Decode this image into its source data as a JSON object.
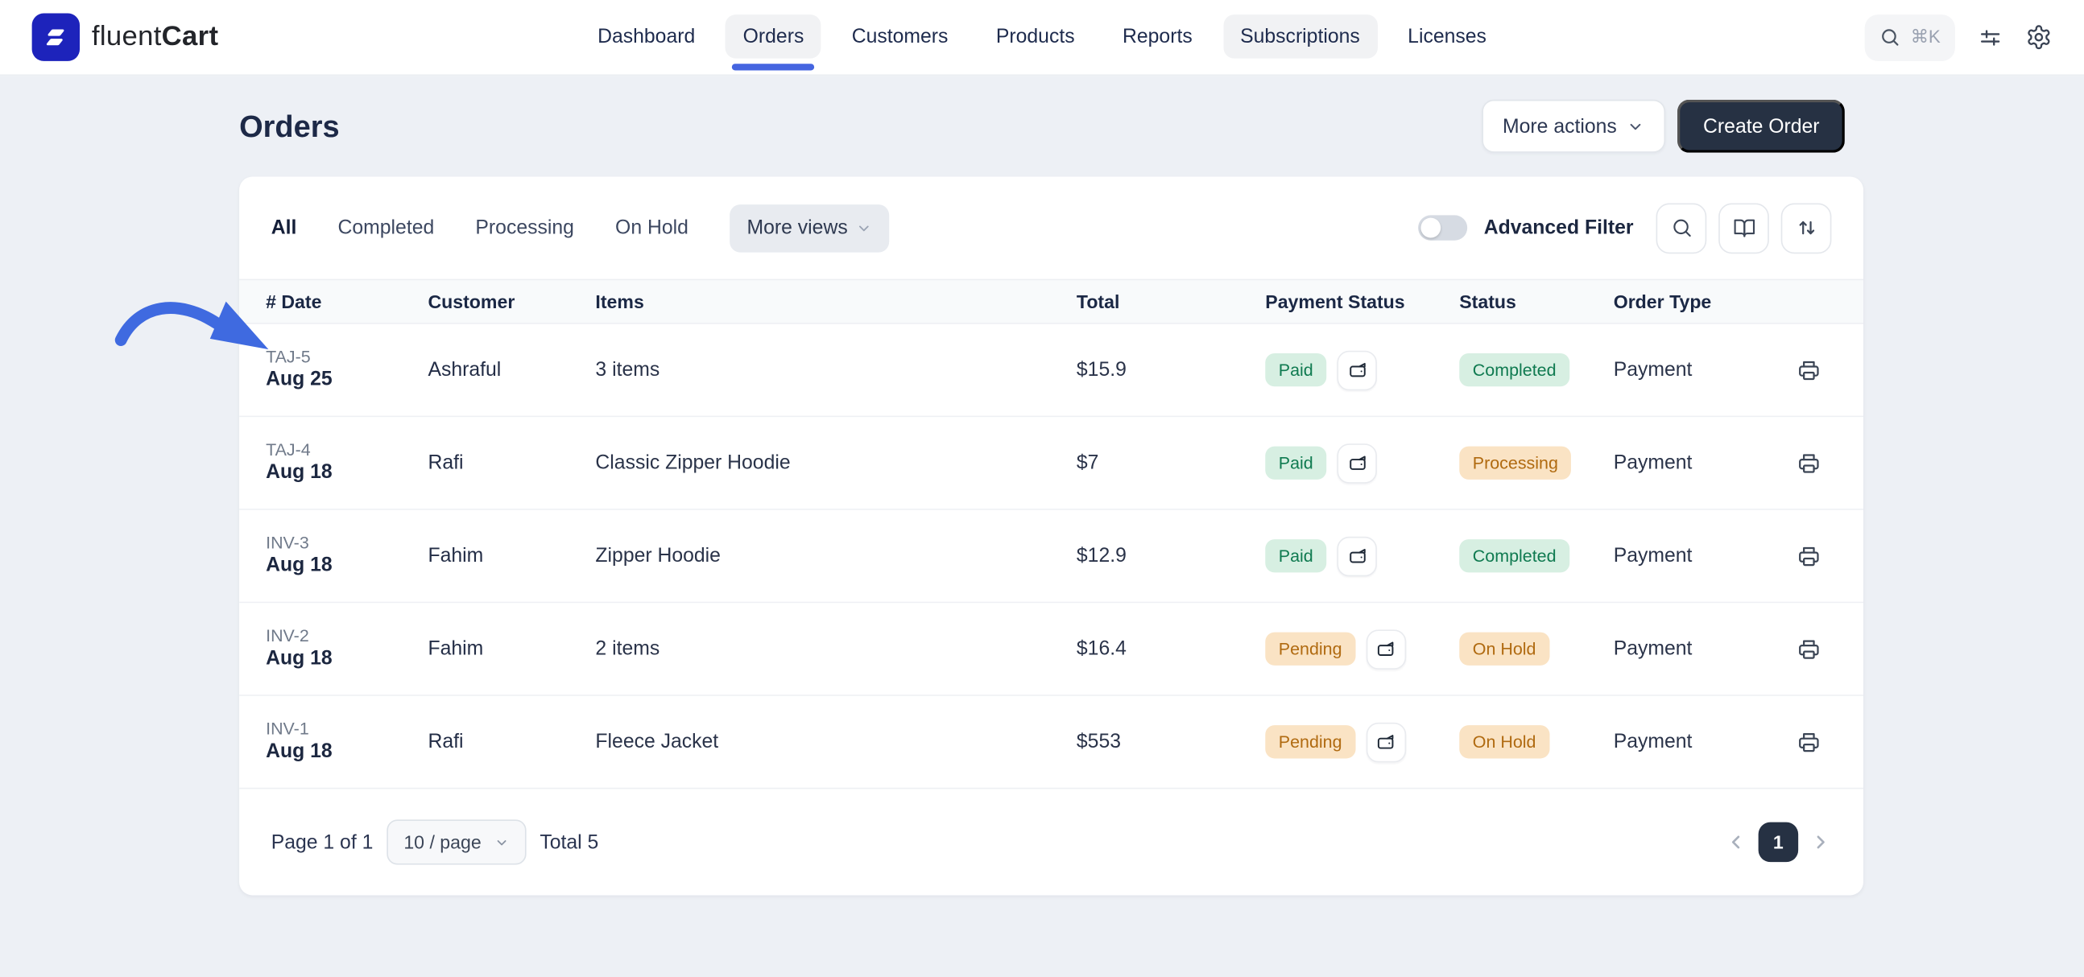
{
  "brand": {
    "light": "fluent",
    "bold": "Cart"
  },
  "nav": {
    "items": [
      {
        "label": "Dashboard"
      },
      {
        "label": "Orders",
        "active": true
      },
      {
        "label": "Customers"
      },
      {
        "label": "Products"
      },
      {
        "label": "Reports"
      },
      {
        "label": "Subscriptions",
        "highlighted": true
      },
      {
        "label": "Licenses"
      }
    ],
    "search_shortcut": "⌘K"
  },
  "page": {
    "title": "Orders"
  },
  "actions": {
    "more_actions": "More actions",
    "create_order": "Create Order"
  },
  "toolbar": {
    "tabs": [
      {
        "label": "All",
        "active": true
      },
      {
        "label": "Completed"
      },
      {
        "label": "Processing"
      },
      {
        "label": "On Hold"
      }
    ],
    "more_views": "More views",
    "advanced_filter": "Advanced Filter"
  },
  "table": {
    "columns": {
      "date": "# Date",
      "customer": "Customer",
      "items": "Items",
      "total": "Total",
      "payment_status": "Payment Status",
      "status": "Status",
      "order_type": "Order Type"
    },
    "rows": [
      {
        "number": "TAJ-5",
        "date": "Aug 25",
        "customer": "Ashraful",
        "items": "3 items",
        "total": "$15.9",
        "payment_status": "Paid",
        "payment_variant": "green",
        "status": "Completed",
        "status_variant": "green",
        "order_type": "Payment"
      },
      {
        "number": "TAJ-4",
        "date": "Aug 18",
        "customer": "Rafi",
        "items": "Classic Zipper Hoodie",
        "total": "$7",
        "payment_status": "Paid",
        "payment_variant": "green",
        "status": "Processing",
        "status_variant": "orange",
        "order_type": "Payment"
      },
      {
        "number": "INV-3",
        "date": "Aug 18",
        "customer": "Fahim",
        "items": "Zipper Hoodie",
        "total": "$12.9",
        "payment_status": "Paid",
        "payment_variant": "green",
        "status": "Completed",
        "status_variant": "green",
        "order_type": "Payment"
      },
      {
        "number": "INV-2",
        "date": "Aug 18",
        "customer": "Fahim",
        "items": "2 items",
        "total": "$16.4",
        "payment_status": "Pending",
        "payment_variant": "orange",
        "status": "On Hold",
        "status_variant": "orange",
        "order_type": "Payment"
      },
      {
        "number": "INV-1",
        "date": "Aug 18",
        "customer": "Rafi",
        "items": "Fleece Jacket",
        "total": "$553",
        "payment_status": "Pending",
        "payment_variant": "orange",
        "status": "On Hold",
        "status_variant": "orange",
        "order_type": "Payment"
      }
    ]
  },
  "pagination": {
    "page_text": "Page 1 of 1",
    "per_page": "10 / page",
    "total_text": "Total 5",
    "current_page": "1"
  },
  "icons": {
    "logo": "fluentcart-slashes",
    "search": "magnifier",
    "shortcut": "command-k",
    "adjustments": "sliders",
    "settings": "gear",
    "chevron": "chevron-down",
    "lookup": "magnifier",
    "docs": "book-open",
    "sort": "arrows-up-down",
    "payment_method": "wallet",
    "print": "printer",
    "prev": "chevron-left",
    "next": "chevron-right",
    "annotation": "curved-blue-arrow"
  },
  "colors": {
    "accent_blue": "#4565e0",
    "brand_blue": "#1d23bb",
    "dark_button": "#263143",
    "badge_green_bg": "#d7efe2",
    "badge_green_text": "#0f7a50",
    "badge_orange_bg": "#fae3c4",
    "badge_orange_text": "#b06a10",
    "page_bg": "#edf0f5",
    "arrow_blue": "#3f6ae0"
  }
}
